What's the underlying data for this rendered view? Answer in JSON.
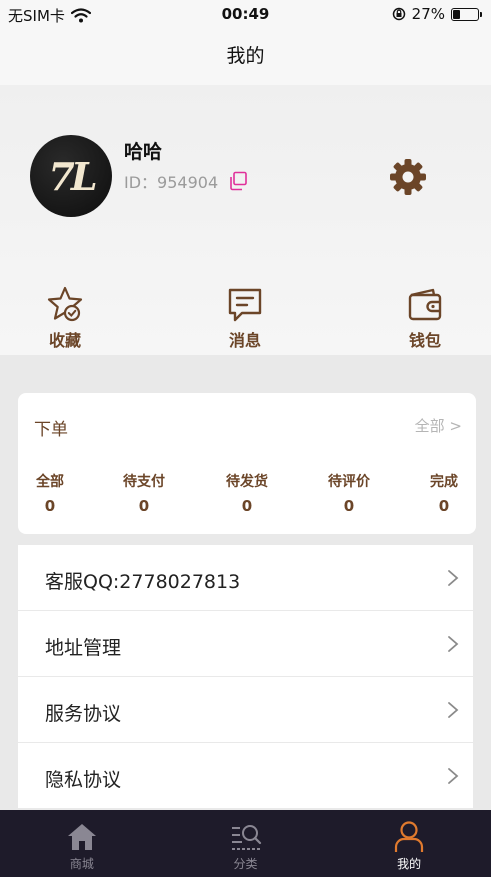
{
  "status_bar": {
    "carrier": "无SIM卡",
    "time": "00:49",
    "battery": "27%",
    "battery_level": 0.27,
    "icons": [
      "wifi-icon",
      "orientation-lock-icon",
      "battery-icon"
    ]
  },
  "nav": {
    "title": "我的"
  },
  "profile": {
    "avatar_text": "7L",
    "name": "哈哈",
    "id_label": "ID：",
    "id_value": "954904",
    "icons": {
      "copy": "copy-icon",
      "settings": "gear-icon"
    }
  },
  "shortcuts": [
    {
      "label": "收藏",
      "icon": "star-check-icon"
    },
    {
      "label": "消息",
      "icon": "message-icon"
    },
    {
      "label": "钱包",
      "icon": "wallet-icon"
    }
  ],
  "orders": {
    "title": "下单",
    "all_label": "全部 >",
    "items": [
      {
        "label": "全部",
        "count": "0"
      },
      {
        "label": "待支付",
        "count": "0"
      },
      {
        "label": "待发货",
        "count": "0"
      },
      {
        "label": "待评价",
        "count": "0"
      },
      {
        "label": "完成",
        "count": "0"
      }
    ]
  },
  "menu": [
    {
      "label": "客服QQ:2778027813"
    },
    {
      "label": "地址管理"
    },
    {
      "label": "服务协议"
    },
    {
      "label": "隐私协议"
    }
  ],
  "tabs": [
    {
      "label": "商城",
      "icon": "home-icon",
      "active": false
    },
    {
      "label": "分类",
      "icon": "category-search-icon",
      "active": false
    },
    {
      "label": "我的",
      "icon": "person-icon",
      "active": true
    }
  ],
  "colors": {
    "accent_brown": "#6b4528",
    "tab_bar": "#1e1b2a",
    "active_orange": "#e07a2e",
    "copy_pink": "#e0309a"
  }
}
